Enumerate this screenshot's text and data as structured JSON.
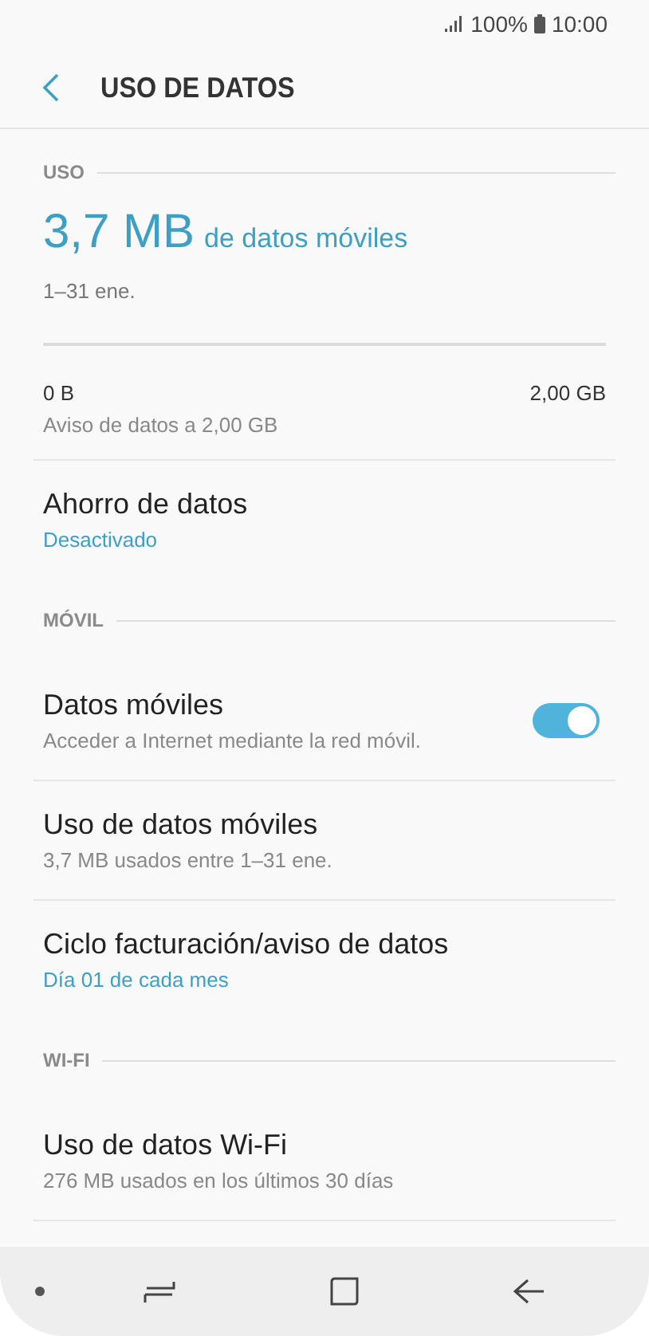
{
  "status_bar": {
    "battery": "100%",
    "time": "10:00"
  },
  "header": {
    "title": "USO DE DATOS"
  },
  "usage": {
    "section": "USO",
    "amount": "3,7 MB",
    "amount_label": "de datos móviles",
    "period": "1–31 ene.",
    "level": 0,
    "min": "0 B",
    "max": "2,00 GB",
    "warning": "Aviso de datos a 2,00 GB"
  },
  "items_top": [
    {
      "title": "Ahorro de datos",
      "subtitle": "Desactivado",
      "highlighted": true
    }
  ],
  "sections": [
    {
      "title": "MÓVIL",
      "items": [
        {
          "title": "Datos móviles",
          "subtitle": "Acceder a Internet mediante la red móvil.",
          "highlighted": false,
          "kind": "toggle",
          "on": true
        },
        {
          "title": "Uso de datos móviles",
          "subtitle": "3,7 MB usados entre 1–31 ene.",
          "highlighted": false,
          "kind": "link"
        },
        {
          "title": "Ciclo facturación/aviso de datos",
          "subtitle": "Día 01 de cada mes",
          "highlighted": true,
          "kind": "link"
        }
      ]
    },
    {
      "title": "WI-FI",
      "items": [
        {
          "title": "Uso de datos Wi-Fi",
          "subtitle": "276 MB usados en los últimos 30 días",
          "highlighted": false,
          "kind": "link"
        }
      ]
    }
  ]
}
